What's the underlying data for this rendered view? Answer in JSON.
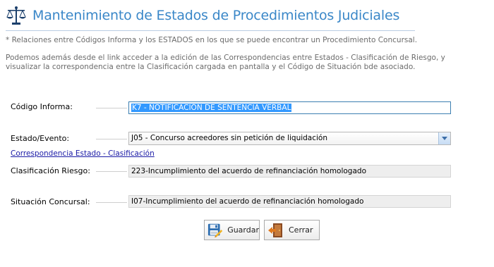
{
  "header": {
    "title": "Mantenimiento de Estados de Procedimientos Judiciales",
    "icon": "scales-icon"
  },
  "descriptions": {
    "note": "* Relaciones entre Códigos Informa y los ESTADOS en los que se puede encontrar un Procedimiento Concursal.",
    "line1": "Podemos además desde el link acceder a la edición de las Correspondencias entre Estados - Clasificación de Riesgo, y",
    "line2": "visualizar la correspondencia entre la Clasificación cargada en pantalla y el Código de Situación bde asociado."
  },
  "form": {
    "codigo_label": "Código Informa:",
    "codigo_value": "K7 - NOTIFICACIÓN DE SENTENCIA VERBAL",
    "estado_label": "Estado/Evento:",
    "estado_value": "J05 - Concurso acreedores sin petición de liquidación",
    "link_text": "Correspondencia Estado - Clasificación",
    "clasificacion_label": "Clasificación Riesgo:",
    "clasificacion_value": "223-Incumplimiento del acuerdo de refinanciación homologado",
    "situacion_label": "Situación Concursal:",
    "situacion_value": "I07-Incumplimiento del acuerdo de refinanciación homologado"
  },
  "buttons": {
    "save_label": "Guardar",
    "save_icon": "floppy-disk-icon",
    "close_label": "Cerrar",
    "close_icon": "exit-door-icon"
  },
  "colors": {
    "title": "#3a87c8",
    "selection": "#3399ff",
    "link": "#1a1aa6"
  }
}
